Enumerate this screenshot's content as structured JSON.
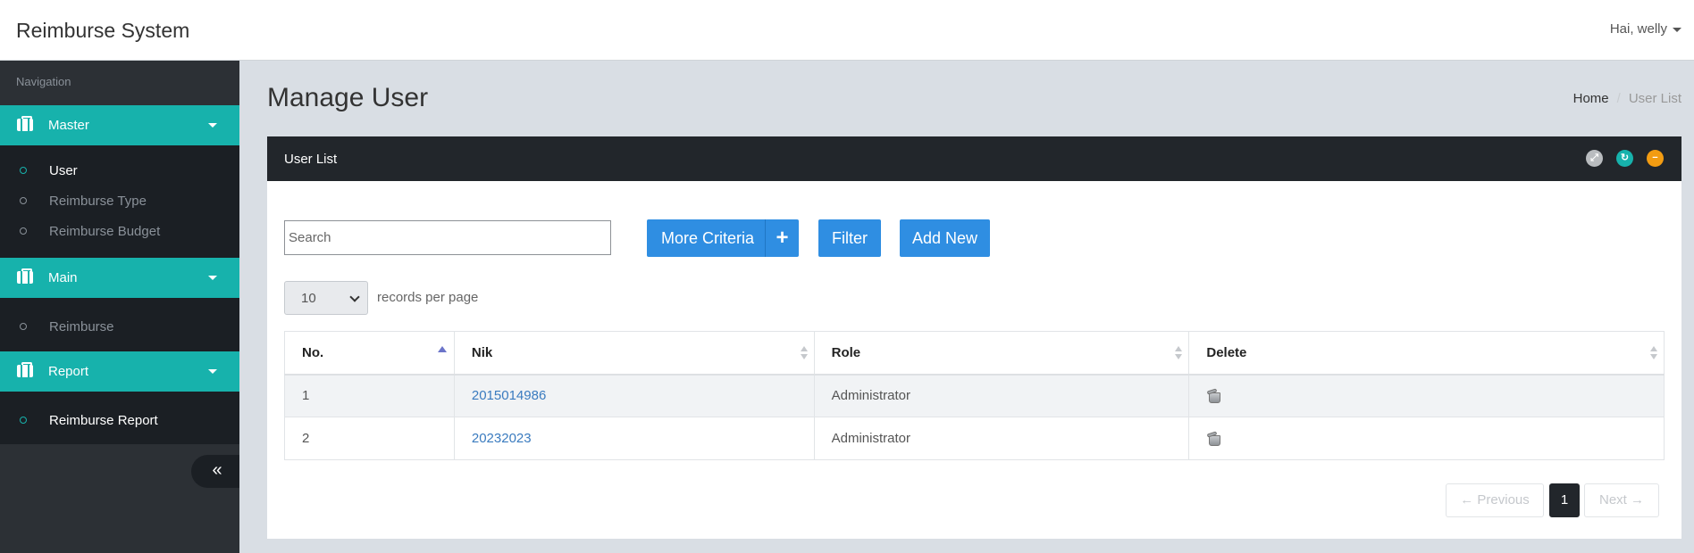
{
  "app": {
    "title": "Reimburse System",
    "user_greeting": "Hai, welly"
  },
  "sidebar": {
    "caption": "Navigation",
    "groups": [
      {
        "label": "Master",
        "items": [
          "User",
          "Reimburse Type",
          "Reimburse Budget"
        ]
      },
      {
        "label": "Main",
        "items": [
          "Reimburse"
        ]
      },
      {
        "label": "Report",
        "items": [
          "Reimburse Report"
        ]
      }
    ],
    "collapse_glyph": "«"
  },
  "page": {
    "title": "Manage User",
    "breadcrumb": {
      "home": "Home",
      "separator": "/",
      "current": "User List"
    }
  },
  "panel": {
    "title": "User List",
    "controls": {
      "expand_glyph": "⤢",
      "reload_glyph": "↻",
      "minimize_glyph": "−"
    },
    "search": {
      "placeholder": "Search",
      "value": ""
    },
    "buttons": {
      "more_criteria": "More Criteria",
      "plus": "+",
      "filter": "Filter",
      "add_new": "Add New"
    },
    "page_size": {
      "value": "10",
      "label": "records per page"
    },
    "table": {
      "columns": [
        "No.",
        "Nik",
        "Role",
        "Delete"
      ],
      "rows": [
        {
          "no": "1",
          "nik": "2015014986",
          "role": "Administrator"
        },
        {
          "no": "2",
          "nik": "20232023",
          "role": "Administrator"
        }
      ]
    },
    "pagination": {
      "previous": "← Previous",
      "current": "1",
      "next": "Next →"
    }
  },
  "colors": {
    "accent": "#17b2ac",
    "primary_button": "#2f8ee2",
    "panel_header": "#22262b",
    "sidebar": "#2c3035"
  }
}
